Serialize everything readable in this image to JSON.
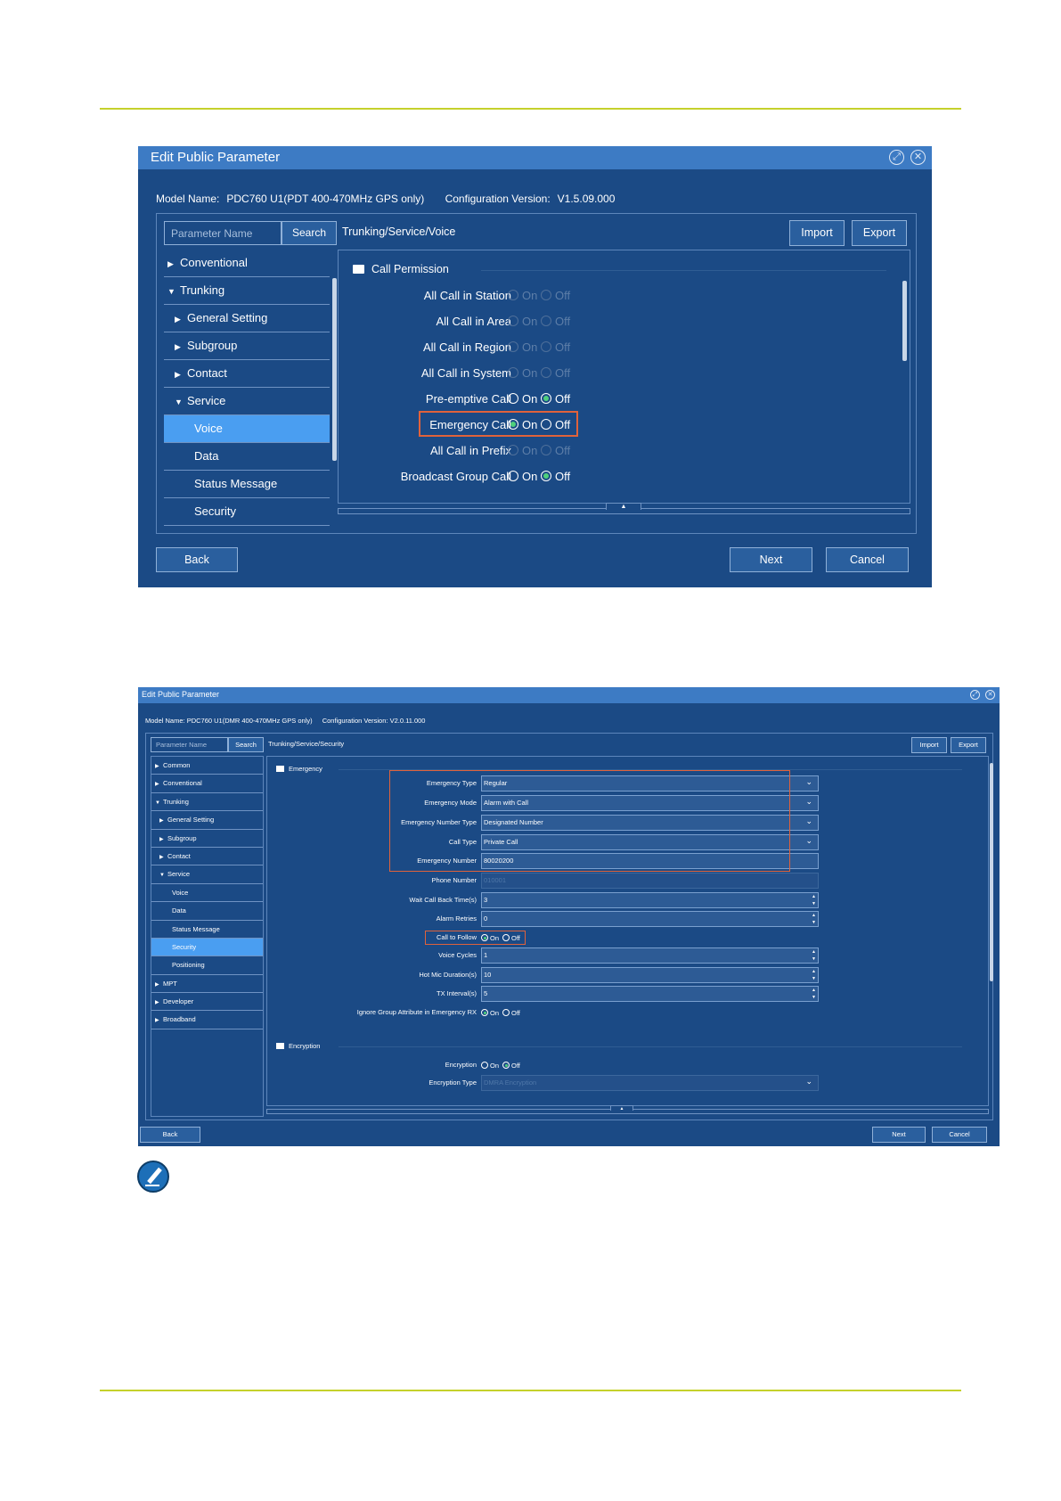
{
  "window1": {
    "title": "Edit Public Parameter",
    "model_label": "Model Name:",
    "model_value": "PDC760 U1(PDT 400-470MHz GPS only)",
    "config_label": "Configuration Version:",
    "config_value": "V1.5.09.000",
    "search_placeholder": "Parameter Name",
    "search_label": "Search",
    "path": "Trunking/Service/Voice",
    "import_label": "Import",
    "export_label": "Export",
    "tree": [
      {
        "label": "Conventional",
        "arrow": "▶",
        "indent": 0,
        "selected": false
      },
      {
        "label": "Trunking",
        "arrow": "▼",
        "indent": 0,
        "selected": false
      },
      {
        "label": "General Setting",
        "arrow": "▶",
        "indent": 1,
        "selected": false
      },
      {
        "label": "Subgroup",
        "arrow": "▶",
        "indent": 1,
        "selected": false
      },
      {
        "label": "Contact",
        "arrow": "▶",
        "indent": 1,
        "selected": false
      },
      {
        "label": "Service",
        "arrow": "▼",
        "indent": 1,
        "selected": false
      },
      {
        "label": "Voice",
        "arrow": "",
        "indent": 2,
        "selected": true
      },
      {
        "label": "Data",
        "arrow": "",
        "indent": 2,
        "selected": false
      },
      {
        "label": "Status Message",
        "arrow": "",
        "indent": 2,
        "selected": false
      },
      {
        "label": "Security",
        "arrow": "",
        "indent": 2,
        "selected": false
      }
    ],
    "group_title": "Call Permission",
    "on_label": "On",
    "off_label": "Off",
    "rows": [
      {
        "label": "All Call in Station",
        "value": "",
        "disabled": true
      },
      {
        "label": "All Call in Area",
        "value": "",
        "disabled": true
      },
      {
        "label": "All Call in Region",
        "value": "",
        "disabled": true
      },
      {
        "label": "All Call in System",
        "value": "",
        "disabled": true
      },
      {
        "label": "Pre-emptive Call",
        "value": "Off",
        "disabled": false
      },
      {
        "label": "Emergency Call",
        "value": "On",
        "disabled": false,
        "highlighted": true
      },
      {
        "label": "All Call in Prefix",
        "value": "",
        "disabled": true
      },
      {
        "label": "Broadcast Group Call",
        "value": "Off",
        "disabled": false
      }
    ],
    "back_label": "Back",
    "next_label": "Next",
    "cancel_label": "Cancel"
  },
  "window2": {
    "title": "Edit Public Parameter",
    "model_label": "Model Name:",
    "model_value": "PDC760 U1(DMR 400-470MHz GPS only)",
    "config_label": "Configuration Version:",
    "config_value": "V2.0.11.000",
    "search_placeholder": "Parameter Name",
    "search_label": "Search",
    "path": "Trunking/Service/Security",
    "import_label": "Import",
    "export_label": "Export",
    "tree": [
      {
        "label": "Common",
        "arrow": "▶",
        "indent": 0,
        "selected": false
      },
      {
        "label": "Conventional",
        "arrow": "▶",
        "indent": 0,
        "selected": false
      },
      {
        "label": "Trunking",
        "arrow": "▼",
        "indent": 0,
        "selected": false
      },
      {
        "label": "General Setting",
        "arrow": "▶",
        "indent": 1,
        "selected": false
      },
      {
        "label": "Subgroup",
        "arrow": "▶",
        "indent": 1,
        "selected": false
      },
      {
        "label": "Contact",
        "arrow": "▶",
        "indent": 1,
        "selected": false
      },
      {
        "label": "Service",
        "arrow": "▼",
        "indent": 1,
        "selected": false
      },
      {
        "label": "Voice",
        "arrow": "",
        "indent": 2,
        "selected": false
      },
      {
        "label": "Data",
        "arrow": "",
        "indent": 2,
        "selected": false
      },
      {
        "label": "Status Message",
        "arrow": "",
        "indent": 2,
        "selected": false
      },
      {
        "label": "Security",
        "arrow": "",
        "indent": 2,
        "selected": true
      },
      {
        "label": "Positioning",
        "arrow": "",
        "indent": 2,
        "selected": false
      },
      {
        "label": "MPT",
        "arrow": "▶",
        "indent": 0,
        "selected": false
      },
      {
        "label": "Developer",
        "arrow": "▶",
        "indent": 0,
        "selected": false
      },
      {
        "label": "Broadband",
        "arrow": "▶",
        "indent": 0,
        "selected": false
      }
    ],
    "emergency_group": "Emergency",
    "encryption_group": "Encryption",
    "on_label": "On",
    "off_label": "Off",
    "fields": [
      {
        "label": "Emergency Type",
        "kind": "select",
        "value": "Regular"
      },
      {
        "label": "Emergency Mode",
        "kind": "select",
        "value": "Alarm with Call"
      },
      {
        "label": "Emergency Number Type",
        "kind": "select",
        "value": "Designated Number"
      },
      {
        "label": "Call Type",
        "kind": "select",
        "value": "Private Call"
      },
      {
        "label": "Emergency Number",
        "kind": "text",
        "value": "80020200"
      },
      {
        "label": "Phone Number",
        "kind": "text-disabled",
        "value": "010001"
      },
      {
        "label": "Wait Call Back Time(s)",
        "kind": "spin",
        "value": "3"
      },
      {
        "label": "Alarm Retries",
        "kind": "spin",
        "value": "0"
      },
      {
        "label": "Call to Follow",
        "kind": "radio",
        "value": "On"
      },
      {
        "label": "Voice Cycles",
        "kind": "spin",
        "value": "1"
      },
      {
        "label": "Hot Mic Duration(s)",
        "kind": "spin",
        "value": "10"
      },
      {
        "label": "TX Interval(s)",
        "kind": "spin",
        "value": "5"
      },
      {
        "label": "Ignore Group Attribute in Emergency RX",
        "kind": "radio",
        "value": "On"
      }
    ],
    "encryption_fields": [
      {
        "label": "Encryption",
        "kind": "radio",
        "value": "Off"
      },
      {
        "label": "Encryption Type",
        "kind": "select-disabled",
        "value": "DMRA Encryption"
      }
    ],
    "back_label": "Back",
    "next_label": "Next",
    "cancel_label": "Cancel"
  }
}
